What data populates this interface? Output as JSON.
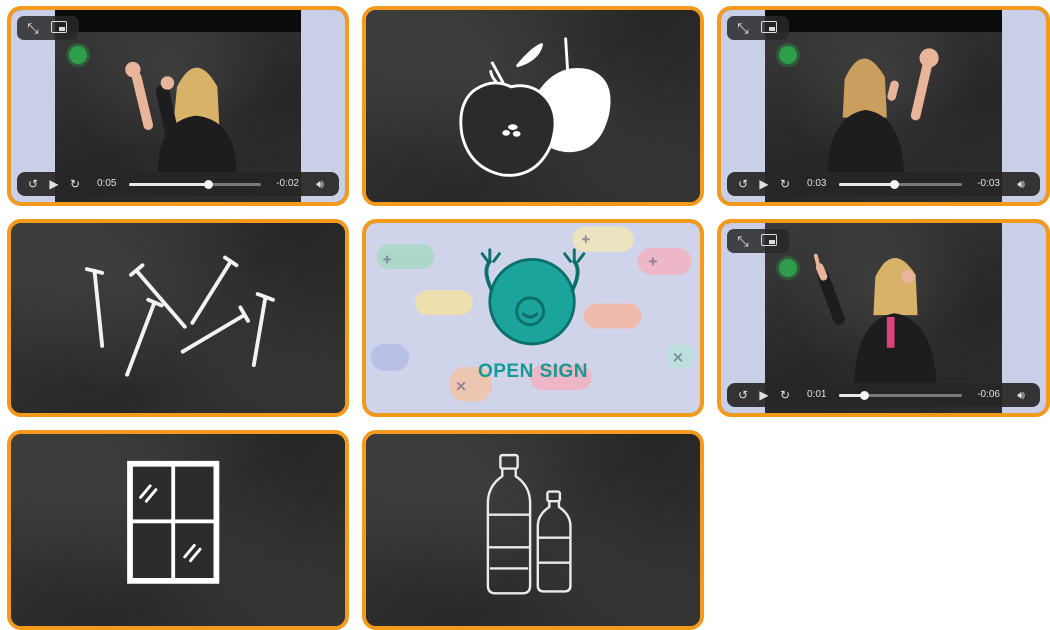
{
  "tiles": {
    "video_1": {
      "elapsed": "0:05",
      "remaining": "-0:02",
      "progress": 0.6
    },
    "video_2": {
      "elapsed": "0:03",
      "remaining": "-0:03",
      "progress": 0.45
    },
    "video_3": {
      "elapsed": "0:01",
      "remaining": "-0:06",
      "progress": 0.2
    },
    "apple_card": {
      "icon": "apples-icon"
    },
    "nails_card": {
      "icon": "nails-icon"
    },
    "open_sign_card": {
      "brand": "OPEN SIGN",
      "icon": "open-sign-logo"
    },
    "window_card": {
      "icon": "window-icon"
    },
    "bottles_card": {
      "icon": "bottles-icon"
    }
  },
  "colors": {
    "tile_border": "#f39a1d",
    "chalkboard": "#2c2c2c",
    "brand_teal": "#159a94",
    "video_side": "#c9cfe6"
  }
}
